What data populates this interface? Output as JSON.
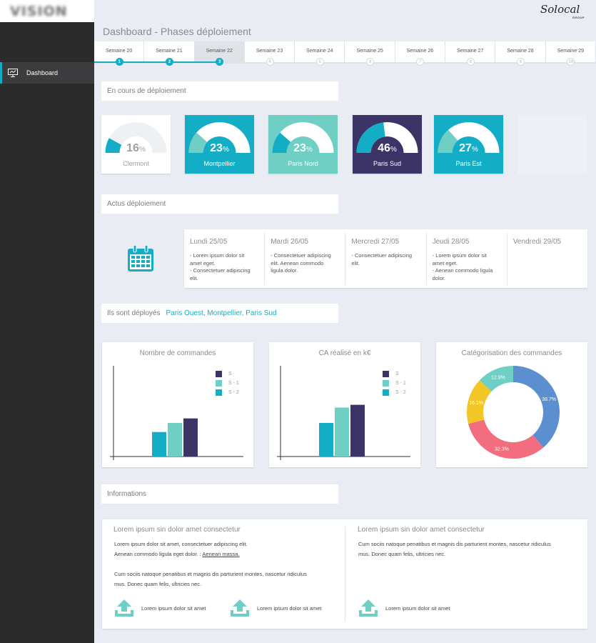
{
  "app": {
    "brand": "Solocal",
    "brand_sub": "GROUP"
  },
  "sidebar": {
    "items": [
      {
        "label": "Dashboard",
        "icon": "presentation-icon",
        "active": true
      }
    ]
  },
  "header": {
    "title": "Dashboard - Phases déploiement"
  },
  "weeks": [
    {
      "label": "Semaine 20",
      "step": "1",
      "state": "done"
    },
    {
      "label": "Semaine 21",
      "step": "2",
      "state": "done"
    },
    {
      "label": "Semaine 22",
      "step": "3",
      "state": "current"
    },
    {
      "label": "Semaine 23",
      "step": "4",
      "state": "todo"
    },
    {
      "label": "Semaine 24",
      "step": "5",
      "state": "todo"
    },
    {
      "label": "Semaine 25",
      "step": "6",
      "state": "todo"
    },
    {
      "label": "Semaine 26",
      "step": "7",
      "state": "todo"
    },
    {
      "label": "Semaine 27",
      "step": "8",
      "state": "todo"
    },
    {
      "label": "Semaine 28",
      "step": "9",
      "state": "todo"
    },
    {
      "label": "Semaine 29",
      "step": "10",
      "state": "todo"
    }
  ],
  "sections": {
    "en_cours": "En cours de déploiement",
    "actus": "Actus déploiement",
    "deployes_label": "Ils sont déployés",
    "deployes_value": "Paris Ouest, Montpellier, Paris Sud",
    "informations": "Informations"
  },
  "gauges": [
    {
      "city": "Clermont",
      "value": "16",
      "unit": "%",
      "percent": 16,
      "bg": "#ffffff",
      "fill": "#14adc6",
      "track": "#eef1f4",
      "text": "#9aa1a8",
      "city_color": "#9aa1a8"
    },
    {
      "city": "Montpellier",
      "value": "23",
      "unit": "%",
      "percent": 23,
      "bg": "#14adc6",
      "fill": "#6fcfc4",
      "track": "#ffffff",
      "text": "#ffffff",
      "city_color": "#ffffff"
    },
    {
      "city": "Paris Nord",
      "value": "23",
      "unit": "%",
      "percent": 23,
      "bg": "#6fcfc4",
      "fill": "#14adc6",
      "track": "#ffffff",
      "text": "#ffffff",
      "city_color": "#ffffff"
    },
    {
      "city": "Paris Sud",
      "value": "46",
      "unit": "%",
      "percent": 46,
      "bg": "#3c3366",
      "fill": "#14adc6",
      "track": "#ffffff",
      "text": "#ffffff",
      "city_color": "#ffffff"
    },
    {
      "city": "Paris Est",
      "value": "27",
      "unit": "%",
      "percent": 27,
      "bg": "#14adc6",
      "fill": "#6fcfc4",
      "track": "#ffffff",
      "text": "#ffffff",
      "city_color": "#ffffff"
    }
  ],
  "news": {
    "icon": "calendar-icon",
    "days": [
      {
        "name": "Lundi 25/05",
        "lines": [
          "- Lorem ipsum dolor sit",
          "amet eget.",
          "- Consectetuer adipiscing",
          "elit."
        ]
      },
      {
        "name": "Mardi 26/05",
        "lines": [
          "- Consectetuer adipiscing",
          "elit. Aenean commodo",
          "ligula dolor."
        ]
      },
      {
        "name": "Mercredi 27/05",
        "lines": [
          "- Consectetuer adipiscing",
          "elit."
        ]
      },
      {
        "name": "Jeudi 28/05",
        "lines": [
          "- Lorem ipsum dolor sit",
          "amet eget.",
          "- Aenean commodo ligula",
          "dolor."
        ]
      },
      {
        "name": "Vendredi 29/05",
        "lines": []
      }
    ]
  },
  "colors": {
    "teal": "#14adc6",
    "mint": "#6fcfc4",
    "navy": "#3c3366",
    "blue": "#5b8fd0",
    "coral": "#f26d7d",
    "yellow": "#f2c624",
    "mint2": "#6fcfc4"
  },
  "chart_data": [
    {
      "type": "bar",
      "title": "Nombre de commandes",
      "categories": [
        ""
      ],
      "series": [
        {
          "name": "S - 2",
          "color": "#14adc6",
          "values": [
            27
          ]
        },
        {
          "name": "S - 1",
          "color": "#6fcfc4",
          "values": [
            37
          ]
        },
        {
          "name": "S",
          "color": "#3c3366",
          "values": [
            42
          ]
        }
      ],
      "ylim": [
        0,
        100
      ],
      "legend_order": [
        "S",
        "S - 1",
        "S - 2"
      ],
      "legend": "top-right"
    },
    {
      "type": "bar",
      "title": "CA réalisé en k€",
      "categories": [
        ""
      ],
      "series": [
        {
          "name": "S - 2",
          "color": "#14adc6",
          "values": [
            37
          ]
        },
        {
          "name": "S - 1",
          "color": "#6fcfc4",
          "values": [
            54
          ]
        },
        {
          "name": "S",
          "color": "#3c3366",
          "values": [
            57
          ]
        }
      ],
      "ylim": [
        0,
        100
      ],
      "legend_order": [
        "S",
        "S - 1",
        "S - 2"
      ],
      "legend": "top-right"
    },
    {
      "type": "pie",
      "title": "Catégorisation des commandes",
      "donut": true,
      "slices": [
        {
          "label": "38.7%",
          "value": 38.7,
          "color": "#5b8fd0"
        },
        {
          "label": "32.3%",
          "value": 32.3,
          "color": "#f26d7d"
        },
        {
          "label": "16.1%",
          "value": 16.1,
          "color": "#f2c624"
        },
        {
          "label": "12.9%",
          "value": 12.9,
          "color": "#6fcfc4"
        }
      ]
    }
  ],
  "info": {
    "col1": {
      "title": "Lorem ipsum sin dolor amet consectetur",
      "line1": "Lorem ipsum dolor sit amet, consectetuer adipiscing elit.",
      "line2": "Aenean commodo ligula eget dolor. :",
      "link": "Aenean massa.",
      "line3": "Cum sociis natoque penatibus et magnis dis parturient montes, nascetur ridiculus",
      "line4": "mus. Donec quam felis, ultricies nec.",
      "dl1": "Lorem ipsum dolor sit amet",
      "dl2": "Lorem ipsum dolor sit amet"
    },
    "col2": {
      "title": "Lorem ipsum sin dolor amet consectetur",
      "line1": "Cum sociis natoque penatibus et magnis dis parturient montes, nascetur ridiculus",
      "line2": "mus. Donec quam felis, ultricies nec.",
      "dl1": "Lorem ipsum dolor sit amet"
    },
    "icon": "upload-icon"
  }
}
